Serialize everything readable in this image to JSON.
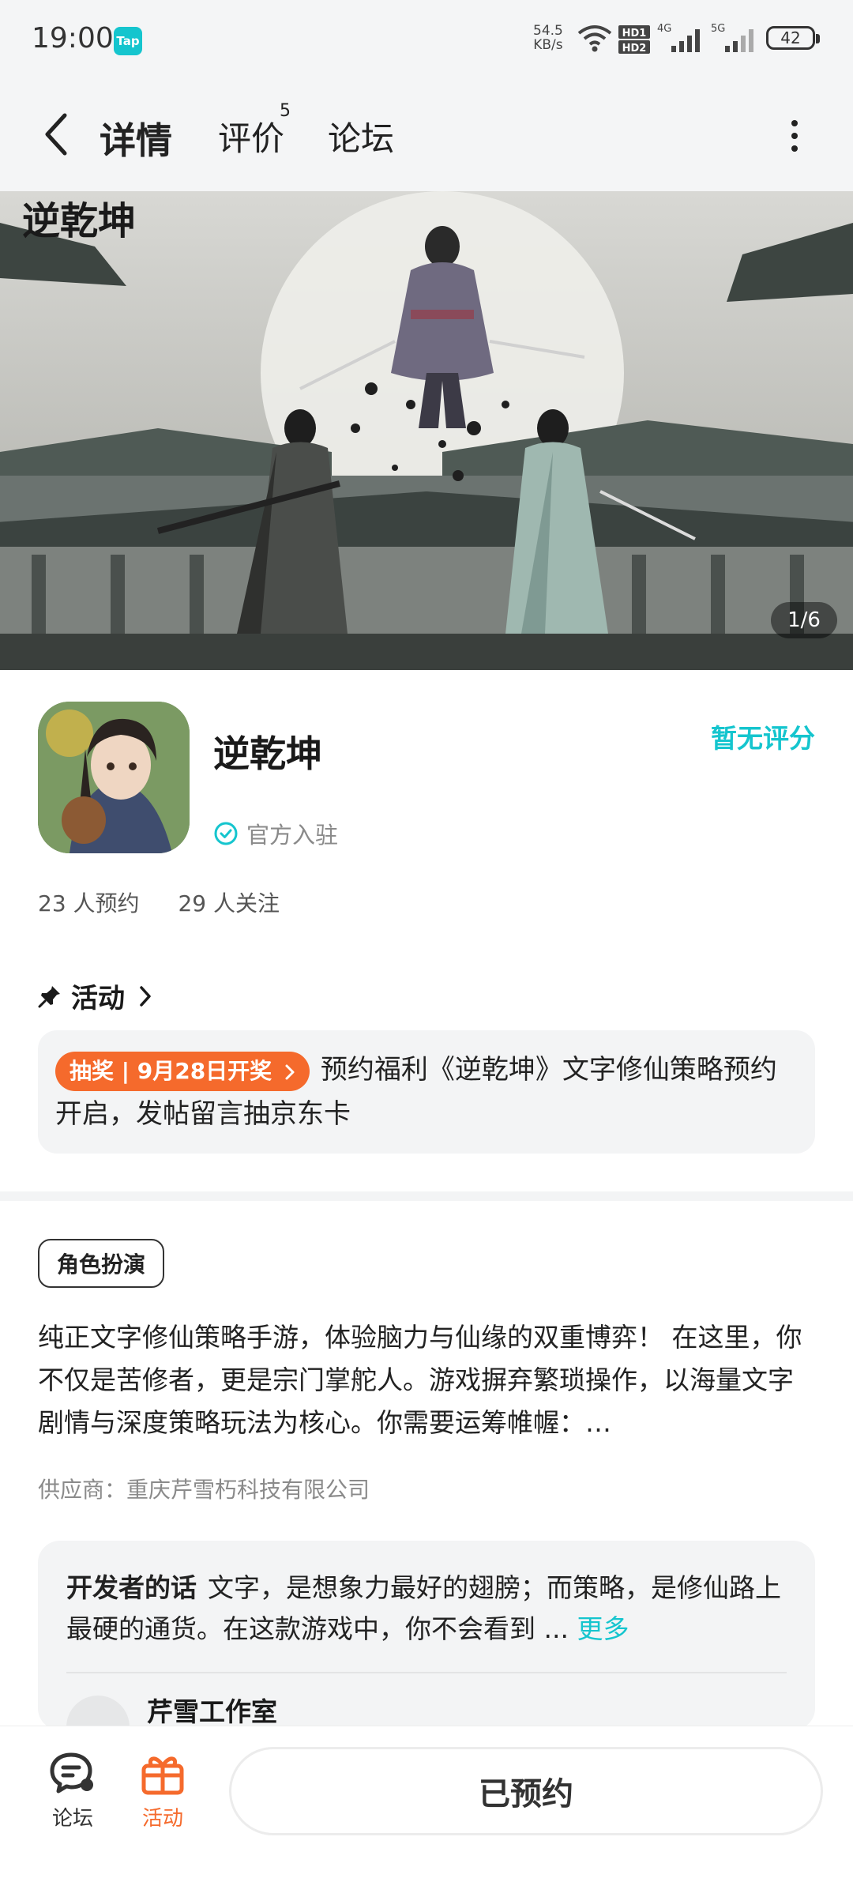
{
  "status_bar": {
    "time": "19:00",
    "app_badge": "Tap",
    "net_speed_value": "54.5",
    "net_speed_unit": "KB/s",
    "hd_label_1": "HD1",
    "hd_label_2": "HD2",
    "sig1_label": "4G",
    "sig2_label": "5G",
    "battery": "42"
  },
  "header": {
    "tabs": [
      {
        "label": "详情"
      },
      {
        "label": "评价",
        "badge": "5"
      },
      {
        "label": "论坛"
      }
    ]
  },
  "banner": {
    "logo_text": "逆乾坤",
    "page_indicator": "1/6"
  },
  "app": {
    "title": "逆乾坤",
    "official_label": "官方入驻",
    "rating_text": "暂无评分",
    "reservations": "23 人预约",
    "followers": "29 人关注"
  },
  "activity": {
    "title": "活动",
    "tag": "抽奖 | 9月28日开奖",
    "text": "预约福利《逆乾坤》文字修仙策略预约开启，发帖留言抽京东卡"
  },
  "genre": {
    "tag": "角色扮演"
  },
  "description": {
    "text": "纯正文字修仙策略手游，体验脑力与仙缘的双重博弈！ 在这里，你不仅是苦修者，更是宗门掌舵人。游戏摒弃繁琐操作，以海量文字剧情与深度策略玩法为核心。你需要运筹帷幄：…",
    "supplier": "供应商：重庆芹雪朽科技有限公司"
  },
  "developer": {
    "label": "开发者的话",
    "text": "文字，是想象力最好的翅膀；而策略，是修仙路上最硬的通货。在这款游戏中，你不会看到 ...",
    "more": "更多",
    "name": "芹雪工作室"
  },
  "bottom_bar": {
    "forum_label": "论坛",
    "activity_label": "活动",
    "reserved_label": "已预约"
  },
  "colors": {
    "accent": "#15c5ce",
    "orange": "#f56a2c"
  }
}
